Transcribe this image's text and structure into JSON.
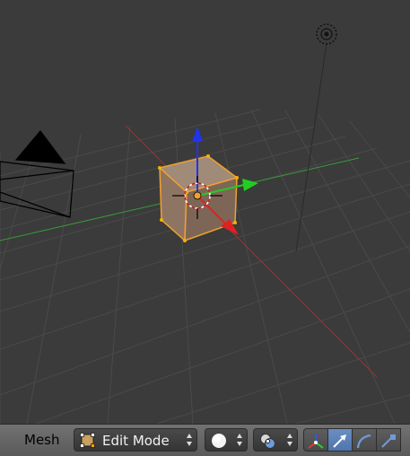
{
  "header": {
    "editor_label": "Mesh",
    "mode_dropdown": {
      "value": "Edit Mode",
      "icon": "edit-mode-icon"
    },
    "shading_dropdown": {
      "icon": "solid-sphere-icon"
    },
    "pivot_dropdown": {
      "icon": "pivot-point-icon"
    },
    "manipulator_buttons": [
      {
        "icon": "manipulator-axes-icon",
        "active": false
      },
      {
        "icon": "translate-arrow-icon",
        "active": true
      },
      {
        "icon": "rotate-arc-icon",
        "active": false
      },
      {
        "icon": "scale-icon",
        "active": false
      }
    ]
  },
  "viewport": {
    "objects": [
      "camera",
      "lamp",
      "cube"
    ],
    "selected_object": "cube",
    "colors": {
      "background": "#3b3b3b",
      "grid": "#474747",
      "x_axis": "#8a3a3a",
      "y_axis": "#3a9a3a",
      "selection": "#f0a030",
      "gizmo_z": "#2233ee",
      "gizmo_y": "#22cc22",
      "gizmo_x": "#dd2222"
    }
  }
}
